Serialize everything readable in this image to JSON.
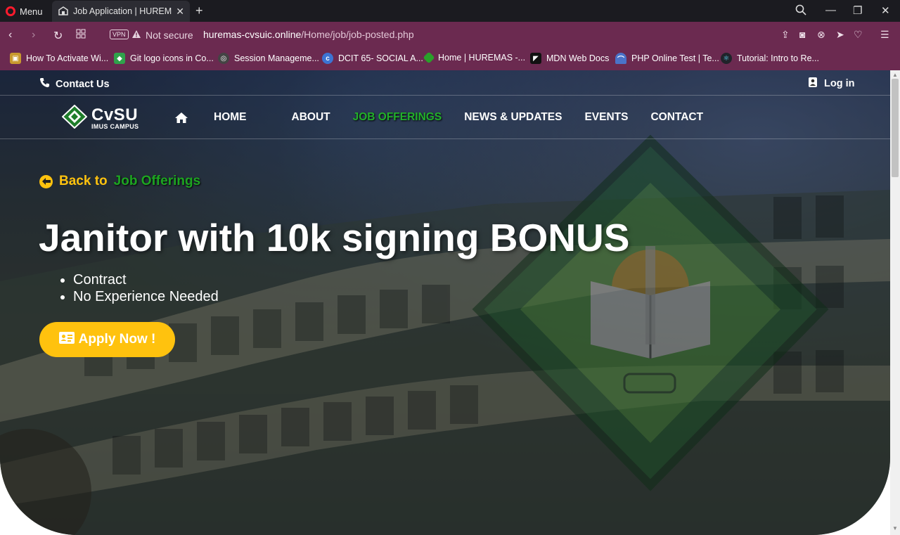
{
  "browser": {
    "menu_label": "Menu",
    "tab_title": "Job Application | HUREMAS",
    "vpn_label": "VPN",
    "security_label": "Not secure",
    "url_host": "huremas-cvsuic.online",
    "url_path": "/Home/job/job-posted.php",
    "accent_color": "#6b2a50"
  },
  "bookmarks": [
    {
      "label": "How To Activate Wi...",
      "icon": "windows-icon",
      "color": "#c99a2e"
    },
    {
      "label": "Git logo icons in Co...",
      "icon": "git-icon",
      "color": "#2fa24b"
    },
    {
      "label": "Session Manageme...",
      "icon": "session-icon",
      "color": "#444444"
    },
    {
      "label": "DCIT 65- SOCIAL A...",
      "icon": "classroom-icon",
      "color": "#3c74d4"
    },
    {
      "label": "Home | HUREMAS -...",
      "icon": "huremas-icon",
      "color": "#2aa02a"
    },
    {
      "label": "MDN Web Docs",
      "icon": "mdn-icon",
      "color": "#111111"
    },
    {
      "label": "PHP Online Test | Te...",
      "icon": "php-icon",
      "color": "#4a73c9"
    },
    {
      "label": "Tutorial: Intro to Re...",
      "icon": "react-icon",
      "color": "#20232a"
    }
  ],
  "site": {
    "contact_us": "Contact Us",
    "login": "Log in",
    "logo_word": "CvSU",
    "logo_sub": "IMUS CAMPUS",
    "nav": {
      "home": "HOME",
      "about": "ABOUT",
      "job_offerings": "JOB OFFERINGS",
      "news": "NEWS & UPDATES",
      "events": "EVENTS",
      "contact": "CONTACT"
    },
    "active_color": "#22b02a"
  },
  "job": {
    "back_prefix": "Back to",
    "back_target": "Job Offerings",
    "title": "Janitor with 10k signing BONUS",
    "tags": [
      "Contract",
      "No Experience Needed"
    ],
    "apply_label": "Apply Now !",
    "apply_color": "#ffc20e"
  }
}
